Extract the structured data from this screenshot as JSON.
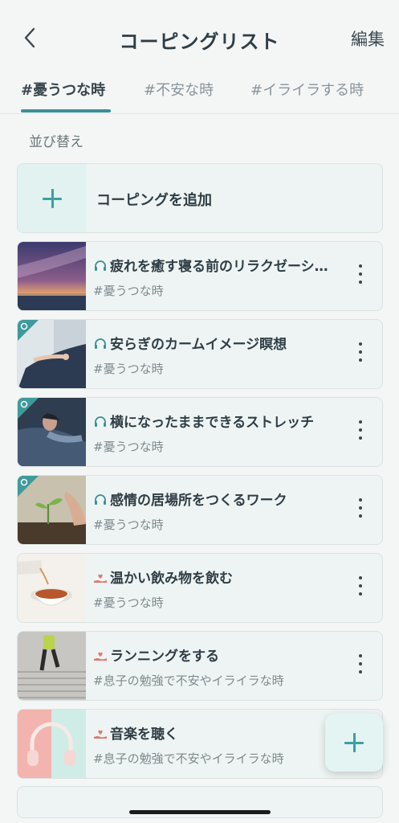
{
  "header": {
    "title": "コーピングリスト",
    "edit_label": "編集",
    "back_icon": "chevron-left-icon"
  },
  "tabs": [
    {
      "label": "#憂うつな時",
      "active": true
    },
    {
      "label": "#不安な時",
      "active": false
    },
    {
      "label": "#イライラする時",
      "active": false
    }
  ],
  "sort_label": "並び替え",
  "add_card": {
    "label": "コーピングを追加",
    "icon": "plus-icon"
  },
  "items": [
    {
      "title": "疲れを癒す寝る前のリラクゼーション",
      "tag": "#憂うつな時",
      "type_icon": "headphones-icon",
      "thumbnail": "milky-way-night-sky",
      "badge": false
    },
    {
      "title": "安らぎのカームイメージ瞑想",
      "tag": "#憂うつな時",
      "type_icon": "headphones-icon",
      "thumbnail": "meditation-hands",
      "badge": true
    },
    {
      "title": "横になったままできるストレッチ",
      "tag": "#憂うつな時",
      "type_icon": "headphones-icon",
      "thumbnail": "person-lying-in-bed",
      "badge": true
    },
    {
      "title": "感情の居場所をつくるワーク",
      "tag": "#憂うつな時",
      "type_icon": "headphones-icon",
      "thumbnail": "seedling-in-soil",
      "badge": true
    },
    {
      "title": "温かい飲み物を飲む",
      "tag": "#憂うつな時",
      "type_icon": "hand-heart-icon",
      "thumbnail": "tea-cup",
      "badge": false
    },
    {
      "title": "ランニングをする",
      "tag": "#息子の勉強で不安やイライラな時",
      "type_icon": "hand-heart-icon",
      "thumbnail": "runner-on-stairs",
      "badge": false
    },
    {
      "title": "音楽を聴く",
      "tag": "#息子の勉強で不安やイライラな時",
      "type_icon": "hand-heart-icon",
      "thumbnail": "headphones-pink",
      "badge": false
    }
  ],
  "fab_icon": "plus-icon",
  "colors": {
    "accent": "#3d8f96",
    "card_bg": "#eef4f3",
    "badge": "#3f9a9c",
    "hand_heart": "#e0786b"
  }
}
